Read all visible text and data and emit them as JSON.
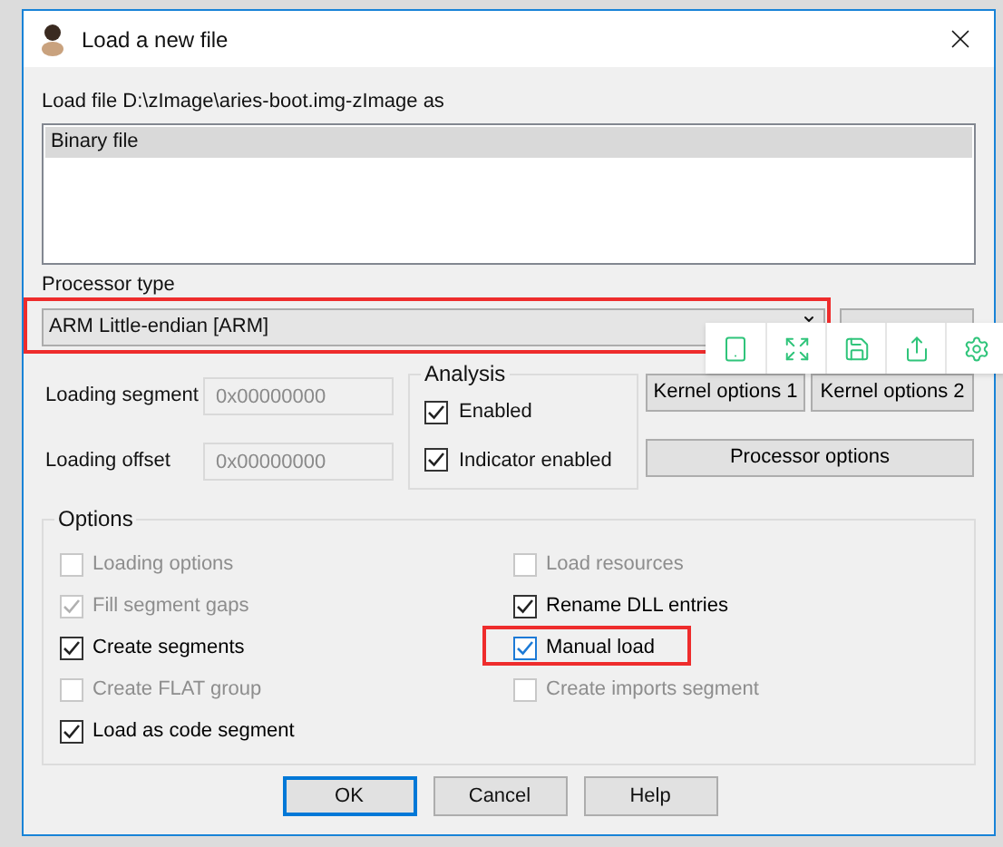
{
  "window": {
    "title": "Load a new file"
  },
  "load_label": "Load file D:\\zImage\\aries-boot.img-zImage as",
  "formats": [
    {
      "label": "Binary file",
      "selected": true
    }
  ],
  "processor": {
    "label": "Processor type",
    "value": "ARM Little-endian [ARM]",
    "highlighted": true
  },
  "loading_segment": {
    "label": "Loading segment",
    "value": "0x00000000",
    "disabled": true
  },
  "loading_offset": {
    "label": "Loading offset",
    "value": "0x00000000",
    "disabled": true
  },
  "analysis": {
    "title": "Analysis",
    "items": [
      {
        "label": "Enabled",
        "checked": true
      },
      {
        "label": "Indicator enabled",
        "checked": true
      }
    ]
  },
  "kernel_buttons": [
    "Kernel options 1",
    "Kernel options 2"
  ],
  "processor_options_button": "Processor options",
  "options": {
    "title": "Options",
    "items": [
      {
        "label": "Loading options",
        "checked": false,
        "disabled": true,
        "highlighted": false,
        "focused": false
      },
      {
        "label": "Load resources",
        "checked": false,
        "disabled": true,
        "highlighted": false,
        "focused": false
      },
      {
        "label": "Fill segment gaps",
        "checked": true,
        "disabled": true,
        "highlighted": false,
        "focused": false
      },
      {
        "label": "Rename DLL entries",
        "checked": true,
        "disabled": false,
        "highlighted": false,
        "focused": false
      },
      {
        "label": "Create segments",
        "checked": true,
        "disabled": false,
        "highlighted": false,
        "focused": false
      },
      {
        "label": "Manual load",
        "checked": true,
        "disabled": false,
        "highlighted": true,
        "focused": true
      },
      {
        "label": "Create FLAT group",
        "checked": false,
        "disabled": true,
        "highlighted": false,
        "focused": false
      },
      {
        "label": "Create imports segment",
        "checked": false,
        "disabled": true,
        "highlighted": false,
        "focused": false
      },
      {
        "label": "Load as code segment",
        "checked": true,
        "disabled": false,
        "highlighted": false,
        "focused": false
      }
    ]
  },
  "buttons": [
    {
      "label": "OK",
      "default": true
    },
    {
      "label": "Cancel",
      "default": false
    },
    {
      "label": "Help",
      "default": false
    }
  ]
}
